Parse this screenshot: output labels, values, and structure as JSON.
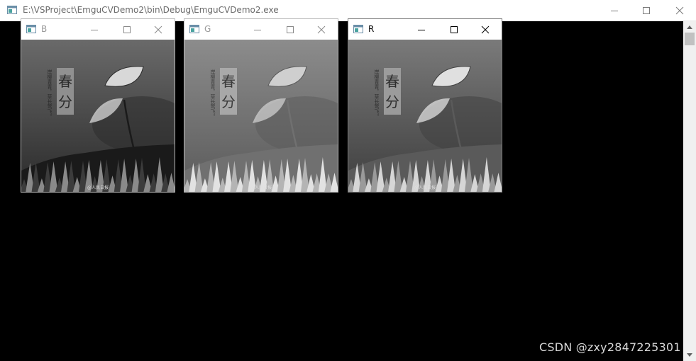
{
  "main_window": {
    "title": "E:\\VSProject\\EmguCVDemo2\\bin\\Debug\\EmguCVDemo2.exe",
    "icon": "console-app-icon"
  },
  "child_windows": [
    {
      "title": "B",
      "active": false,
      "channel": "blue",
      "poem": "岸柳青青，草长莺飞。",
      "badge_line1": "春",
      "badge_line2": "分",
      "credit": "@人民日报"
    },
    {
      "title": "G",
      "active": false,
      "channel": "green",
      "poem": "岸柳青青，草长莺飞。",
      "badge_line1": "春",
      "badge_line2": "分",
      "credit": "@人民日报"
    },
    {
      "title": "R",
      "active": true,
      "channel": "red",
      "poem": "岸柳青青，草长莺飞。",
      "badge_line1": "春",
      "badge_line2": "分",
      "credit": "@人民日报"
    }
  ],
  "watermark": "CSDN @zxy2847225301",
  "colors": {
    "console_bg": "#000000",
    "titlebar_bg": "#ffffff",
    "scrollbar_bg": "#f0f0f0"
  }
}
